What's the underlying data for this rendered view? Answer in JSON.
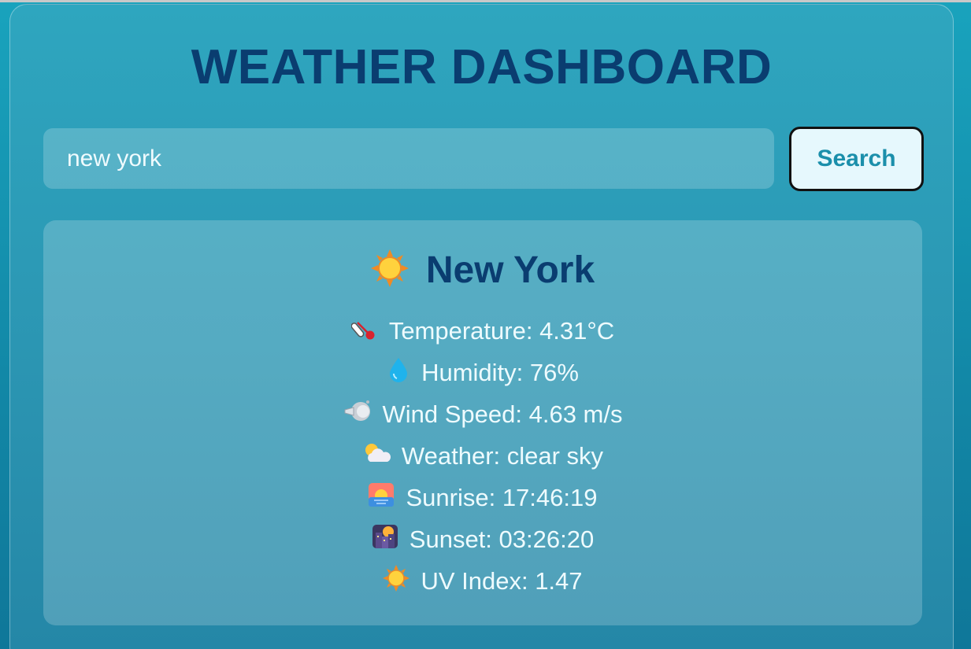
{
  "header": {
    "title": "WEATHER DASHBOARD"
  },
  "search": {
    "value": "new york",
    "button_label": "Search"
  },
  "weather": {
    "city": "New York",
    "stats": {
      "temperature": "Temperature: 4.31°C",
      "humidity": "Humidity: 76%",
      "wind": "Wind Speed: 4.63 m/s",
      "weather": "Weather: clear sky",
      "sunrise": "Sunrise: 17:46:19",
      "sunset": "Sunset: 03:26:20",
      "uv": "UV Index: 1.47"
    }
  },
  "icons": {
    "city": "sun-icon",
    "temperature": "thermometer-icon",
    "humidity": "droplet-icon",
    "wind": "wind-face-icon",
    "weather": "sun-behind-cloud-icon",
    "sunrise": "sunrise-icon",
    "sunset": "city-sunset-icon",
    "uv": "sun-icon"
  },
  "colors": {
    "title": "#0a3d70",
    "accent": "#1b8fab",
    "background": "#1287a6"
  }
}
